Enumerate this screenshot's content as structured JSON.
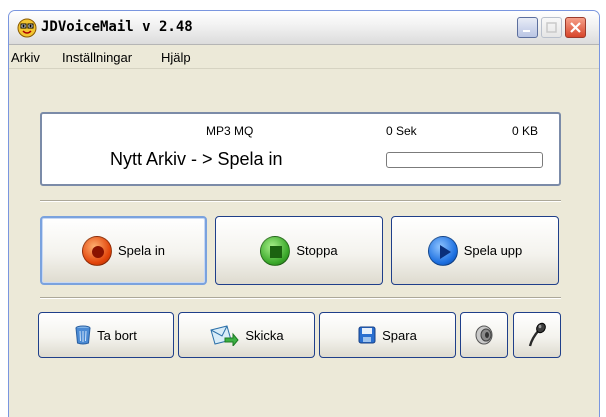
{
  "window": {
    "title": "JDVoiceMail  v 2.48"
  },
  "menu": [
    "Arkiv",
    "Inställningar",
    "Hjälp"
  ],
  "display": {
    "format": "MP3 MQ",
    "seconds": "0 Sek",
    "size": "0 KB",
    "status": "Nytt Arkiv - > Spela in",
    "progress": 0
  },
  "transport": {
    "record": "Spela in",
    "stop": "Stoppa",
    "play": "Spela upp"
  },
  "actions": {
    "delete": "Ta bort",
    "send": "Skicka",
    "save": "Spara"
  },
  "colors": {
    "record": "#e2440a",
    "stop": "#3aa82a",
    "play": "#1c6fe0",
    "border": "#1f3f8a"
  },
  "icons": [
    "app-icon",
    "minimize-icon",
    "maximize-icon",
    "close-icon",
    "record-icon",
    "stop-icon",
    "play-icon",
    "trash-icon",
    "send-icon",
    "save-icon",
    "speaker-icon",
    "microphone-icon"
  ]
}
